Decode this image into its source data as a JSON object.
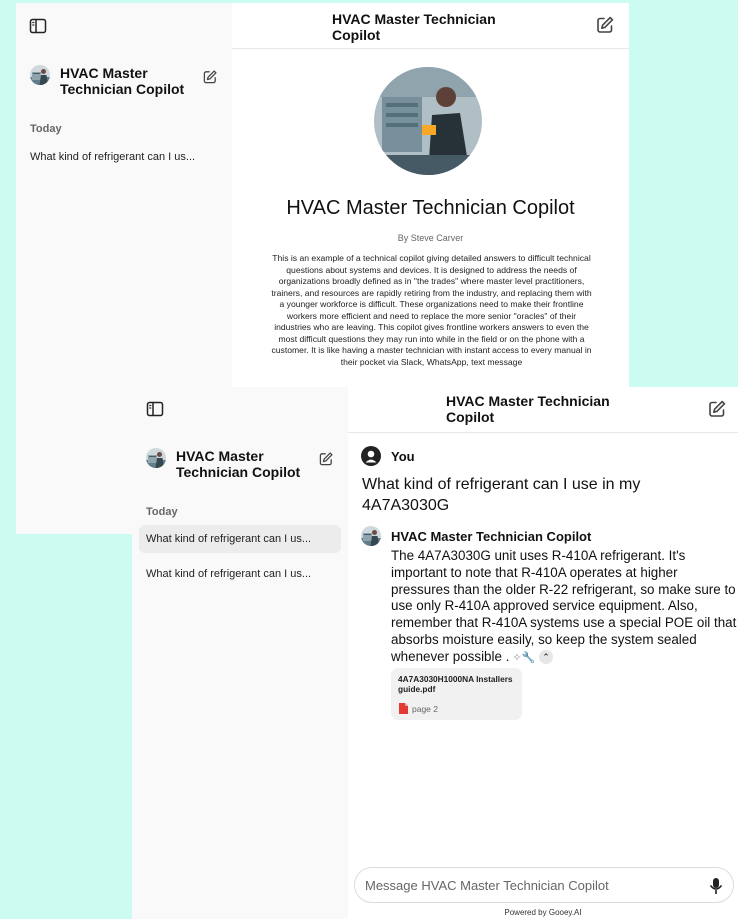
{
  "app": {
    "title": "HVAC Master Technician Copilot",
    "accent_color": "#ccfbf1"
  },
  "sidebar": {
    "toggle_icon": "sidebar-toggle-icon",
    "new_chat_icon": "new-chat-icon",
    "bot_name": "HVAC Master Technician Copilot",
    "section_label": "Today",
    "conversations": [
      {
        "label": "What kind of refrigerant can I use in my 4A7A3030G",
        "display": "What kind of refrigerant can I us..."
      },
      {
        "label": "What kind of refrigerant can I use",
        "display": "What kind of refrigerant can I us..."
      }
    ]
  },
  "intro": {
    "title": "HVAC Master Technician Copilot",
    "byline": "By Steve Carver",
    "description": "This is an example of a technical copilot giving detailed answers to difficult technical questions about systems and devices. It is designed to address the needs of organizations broadly defined as in \"the trades\" where master level practitioners, trainers, and resources are rapidly retiring from the industry, and replacing them with a younger workforce is difficult. These organizations need to make their frontline workers more efficient and need to replace the more senior \"oracles\" of their industries who are leaving. This copilot gives frontline workers answers to even the most difficult questions they may run into while in the field or on the phone with a customer. It is like having a master technician with instant access to every manual in their pocket via Slack, WhatsApp, text message"
  },
  "chat": {
    "user_label": "You",
    "user_message": "What kind of refrigerant can I use in my 4A7A3030G",
    "bot_label": "HVAC Master Technician Copilot",
    "bot_message": "The 4A7A3030G unit uses R-410A refrigerant. It's important to note that R-410A operates at higher pressures than the older R-22 refrigerant, so make sure to use only R-410A approved service equipment. Also, remember that R-410A systems use a special POE oil that absorbs moisture easily, so keep the system sealed whenever possible .",
    "reference": {
      "file": "4A7A3030H1000NA Installers guide.pdf",
      "page": "page 2"
    },
    "composer_placeholder": "Message HVAC Master Technician Copilot",
    "powered_by": "Powered by Gooey.AI"
  }
}
